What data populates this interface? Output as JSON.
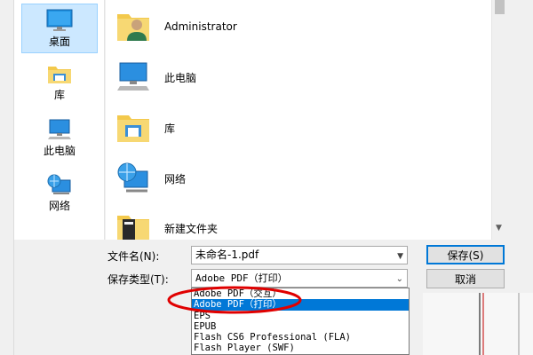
{
  "sidebar": {
    "items": [
      {
        "label": "桌面",
        "icon": "desktop-icon",
        "selected": true
      },
      {
        "label": "库",
        "icon": "library-icon"
      },
      {
        "label": "此电脑",
        "icon": "this-pc-icon"
      },
      {
        "label": "网络",
        "icon": "network-icon"
      }
    ]
  },
  "files": [
    {
      "label": "Administrator",
      "icon": "user-folder-icon"
    },
    {
      "label": "此电脑",
      "icon": "this-pc-icon"
    },
    {
      "label": "库",
      "icon": "library-icon"
    },
    {
      "label": "网络",
      "icon": "network-icon"
    },
    {
      "label": "新建文件夹",
      "icon": "folder-icon"
    }
  ],
  "form": {
    "filename_label": "文件名(N):",
    "filename_value": "未命名-1.pdf",
    "type_label": "保存类型(T):",
    "type_value": "Adobe PDF（打印）"
  },
  "buttons": {
    "save": "保存(S)",
    "cancel": "取消"
  },
  "dropdown": {
    "options": [
      "Adobe PDF（交互）",
      "Adobe PDF（打印）",
      "EPS",
      "EPUB",
      "Flash CS6 Professional (FLA)",
      "Flash Player (SWF)"
    ],
    "selected_index": 1
  },
  "colors": {
    "selection": "#0078d7",
    "sidebar_selected": "#cce8ff",
    "annotation": "#e00000"
  }
}
